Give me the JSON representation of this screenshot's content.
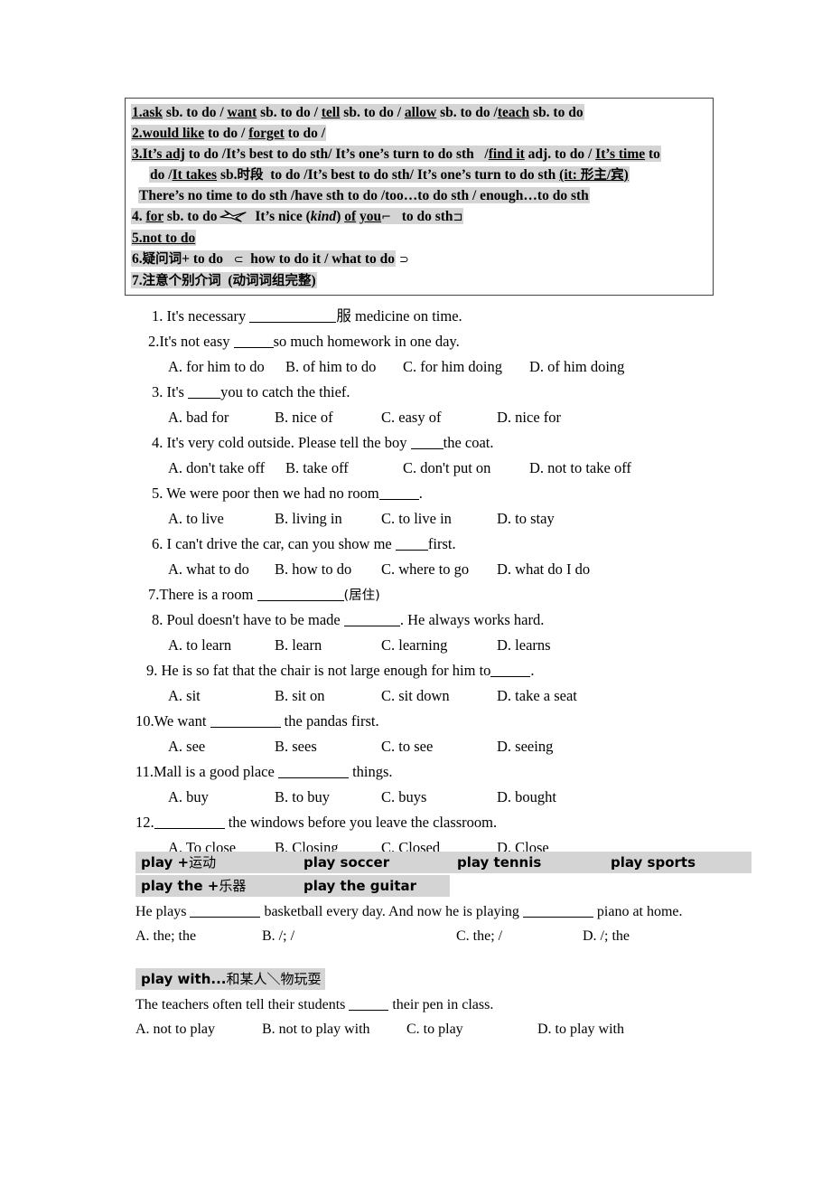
{
  "grammar_box": {
    "lines": [
      {
        "id": 1,
        "num": "1.",
        "parts": [
          {
            "t": "ask",
            "u": true
          },
          {
            "t": " sb. to do / "
          },
          {
            "t": "want",
            "u": true
          },
          {
            "t": " sb. to do / "
          },
          {
            "t": "tell",
            "u": true
          },
          {
            "t": " sb. to do / "
          },
          {
            "t": "allow",
            "u": true
          },
          {
            "t": " sb. to do /"
          },
          {
            "t": "teach",
            "u": true
          },
          {
            "t": " sb. to do"
          }
        ],
        "text": "1.ask sb. to do / want sb. to do / tell sb. to do / allow sb. to do /teach sb. to do"
      },
      {
        "id": 2,
        "text": "2.would like to do / forget to do /"
      },
      {
        "id": 3,
        "text": "3.It's adj to do /It's best to do sth/ It's one's turn to do sth   /find it adj. to do / It's time to"
      },
      {
        "id": 4,
        "text": "do /It takes sb.时段  to do /It's best to do sth/ It's one's turn to do sth (it: 形主/宾)"
      },
      {
        "id": 5,
        "text": "There's no time to do sth /have sth to do /too…to do sth / enough…to do sth"
      },
      {
        "id": 6,
        "text": "4. for sb. to do    It's nice (kind) of you    to do sth."
      },
      {
        "id": 7,
        "text": "5.not to do"
      },
      {
        "id": 8,
        "text": "6.疑问词+ to do    how to do it / what to do"
      },
      {
        "id": 9,
        "text": "7.注意个别介词  (动词词组完整)"
      }
    ]
  },
  "questions": [
    {
      "num": "1.",
      "stem_before": "1. It's necessary ",
      "stem_after": "服 medicine on time.",
      "blank": "b-xl",
      "options": []
    },
    {
      "stem_before": "2.It's not easy ",
      "stem_after": "so much homework in one day.",
      "blank": "b-sm",
      "options": [
        "A. for him to do",
        "B. of him to do",
        "C. for him doing",
        "D. of him doing"
      ]
    },
    {
      "stem_before": "3. It's ",
      "stem_after": "you to catch the thief.",
      "blank": "b-xs",
      "options": [
        "A. bad for",
        "B. nice of",
        "C. easy of",
        "D. nice for"
      ]
    },
    {
      "stem_before": "4. It's very cold outside. Please tell the boy ",
      "stem_after": "the coat.",
      "blank": "b-xs",
      "options": [
        "A. don't take off",
        "B. take off",
        "C. don't put on",
        "D. not to take off"
      ]
    },
    {
      "stem_before": "5. We were poor then we had no room",
      "stem_after": ".",
      "blank": "b-sm",
      "options": [
        "A. to live",
        "B. living in",
        "C. to live in",
        "D. to stay"
      ]
    },
    {
      "stem_before": "6. I can't drive the car, can you show me ",
      "stem_after": "first.",
      "blank": "b-xs",
      "options": [
        "A. what to do",
        "B. how to do",
        "C. where to go",
        "D. what do I do"
      ]
    },
    {
      "stem_before": "7.There is a room ",
      "stem_after": "(居住)",
      "blank": "b-xl",
      "options": []
    },
    {
      "stem_before": "8. Poul doesn't have to be made ",
      "stem_after": ". He always works hard.",
      "blank": "b-md",
      "options": [
        "A. to learn",
        "B. learn",
        "C. learning",
        "D. learns"
      ]
    },
    {
      "stem_before": "9. He is so fat that the chair is not large enough for him to",
      "stem_after": ".",
      "blank": "b-sm",
      "options": [
        "A. sit",
        "B. sit on",
        "C. sit down",
        "D. take a seat"
      ]
    },
    {
      "stem_before": "10.We want ",
      "stem_after": " the pandas first.",
      "blank": "b-lg",
      "options": [
        "A. see",
        "B. sees",
        "C. to see",
        "D. seeing"
      ]
    },
    {
      "stem_before": "11.Mall is a good place ",
      "stem_after": " things.",
      "blank": "b-lg",
      "options": [
        "A. buy",
        "B. to buy",
        "C. buys",
        "D. bought"
      ]
    },
    {
      "stem_before": "12.",
      "stem_after": " the windows before you leave the classroom.",
      "blank": "b-lg",
      "options": [
        "A. To close",
        "B. Closing",
        "C. Closed",
        "D. Close"
      ]
    }
  ],
  "play_section_1": {
    "row1": {
      "c1_bold": "play +",
      "c1_cjk": "运动",
      "c2": "play soccer",
      "c3": "play tennis",
      "c4": "play sports"
    },
    "row2": {
      "c1_bold": "play   the + ",
      "c1_cjk": "乐器",
      "c2": "play the guitar"
    },
    "question": {
      "p1": "He plays ",
      "p2": " basketball every day. And now he is playing ",
      "p3": " piano at home."
    },
    "options": [
      "A. the; the",
      "B. /; /",
      "C. the; /",
      "D. /; the"
    ]
  },
  "play_section_2": {
    "heading_bold": "play with...",
    "heading_cjk": "和某人＼物玩耍",
    "question": {
      "p1": "The teachers often tell their students ",
      "p2": " their pen in class."
    },
    "options": [
      "A. not to play",
      "B. not to play with",
      "C. to play",
      "D. to play with"
    ]
  },
  "colors": {
    "highlight": "#d4d4d4",
    "border": "#444444",
    "text": "#000000"
  }
}
